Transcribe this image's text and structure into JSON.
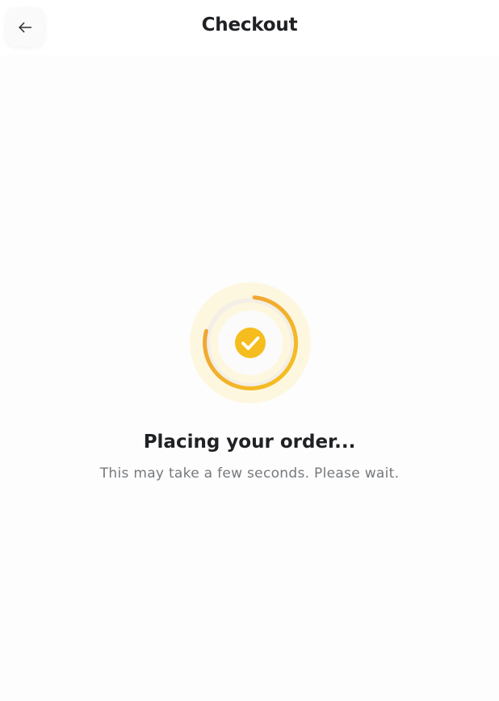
{
  "header": {
    "title": "Checkout",
    "back_icon": "arrow-left-icon"
  },
  "status": {
    "title": "Placing your order...",
    "subtitle": "This may take a few seconds. Please wait.",
    "icon": "check-circle-icon",
    "indicator": "loading-ring"
  },
  "colors": {
    "accent": "#F5BE1E",
    "accent_orange": "#EF9E3A",
    "halo": "#FEF7E0",
    "text_primary": "#1F2124",
    "text_secondary": "#76797D"
  }
}
